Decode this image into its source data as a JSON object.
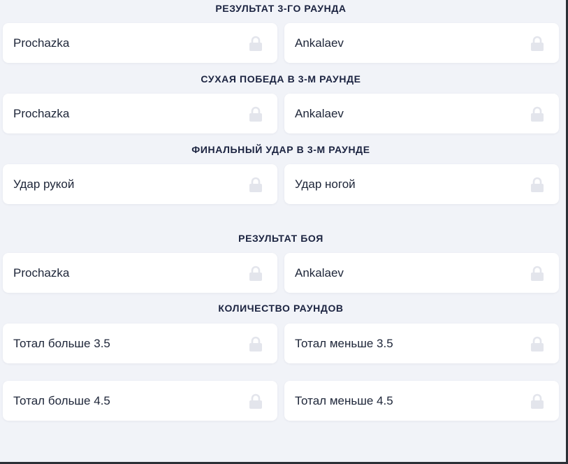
{
  "sections": [
    {
      "title": "РЕЗУЛЬТАТ 3-ГО РАУНДА",
      "rows": [
        [
          "Prochazka",
          "Ankalaev"
        ]
      ]
    },
    {
      "title": "СУХАЯ ПОБЕДА В 3-М РАУНДЕ",
      "rows": [
        [
          "Prochazka",
          "Ankalaev"
        ]
      ]
    },
    {
      "title": "ФИНАЛЬНЫЙ УДАР В 3-М РАУНДЕ",
      "rows": [
        [
          "Удар рукой",
          "Удар ногой"
        ]
      ]
    },
    {
      "title": "РЕЗУЛЬТАТ БОЯ",
      "rows": [
        [
          "Prochazka",
          "Ankalaev"
        ]
      ]
    },
    {
      "title": "КОЛИЧЕСТВО РАУНДОВ",
      "rows": [
        [
          "Тотал больше 3.5",
          "Тотал меньше 3.5"
        ],
        [
          "Тотал больше 4.5",
          "Тотал меньше 4.5"
        ]
      ]
    }
  ],
  "icons": {
    "lock": "lock-icon"
  },
  "colors": {
    "background": "#f1f3f8",
    "card": "#ffffff",
    "text": "#1d2538",
    "title": "#1b2340",
    "lock": "#e3e5ec"
  }
}
